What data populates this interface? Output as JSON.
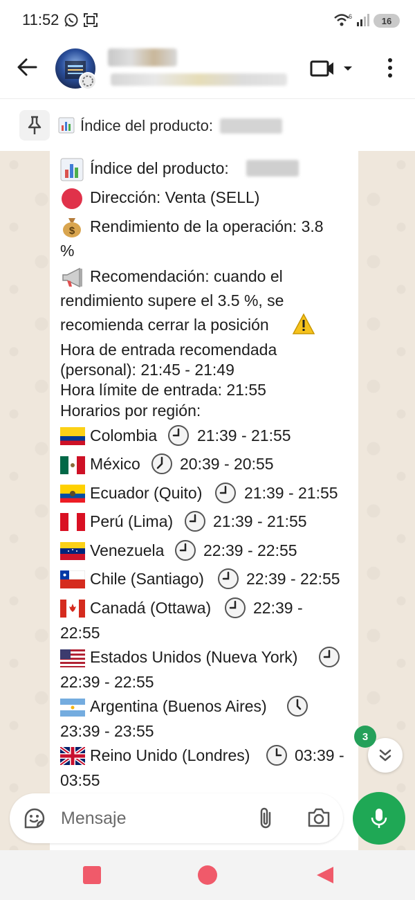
{
  "status_bar": {
    "time": "11:52",
    "battery": "16"
  },
  "header": {
    "icons": [
      "back-arrow-icon",
      "avatar",
      "video-camera-icon",
      "chevron-down-icon",
      "more-vertical-icon"
    ]
  },
  "pinned": {
    "emoji": "📊",
    "text": "Índice del producto:"
  },
  "message": {
    "product_label": "Índice del producto:",
    "direction": "Dirección: Venta (SELL)",
    "yield_line1": "Rendimiento de la operación: 3.8",
    "yield_line2": "%",
    "rec_line1": "Recomendación: cuando el",
    "rec_line2": "rendimiento supere el 3.5 %, se",
    "rec_line3": "recomienda cerrar la posición",
    "entry_line1": "Hora de entrada recomendada",
    "entry_line2": "(personal): 21:45 - 21:49",
    "limit": "Hora límite de entrada: 21:55",
    "regions_title": "Horarios por región:",
    "regions": [
      {
        "name": "Colombia",
        "time": "21:39 - 21:55"
      },
      {
        "name": "México",
        "time": "20:39 - 20:55"
      },
      {
        "name": "Ecuador (Quito)",
        "time": "21:39 - 21:55"
      },
      {
        "name": "Perú (Lima)",
        "time": "21:39 - 21:55"
      },
      {
        "name": "Venezuela",
        "time": "22:39 - 22:55"
      },
      {
        "name": "Chile (Santiago)",
        "time": "22:39 - 22:55"
      },
      {
        "name": "Canadá (Ottawa)",
        "time": "22:39 -",
        "time2": "22:55"
      },
      {
        "name": "Estados Unidos (Nueva York)",
        "time2": "22:39 - 22:55"
      },
      {
        "name": "Argentina (Buenos Aires)",
        "time2": "23:39 - 23:55"
      },
      {
        "name": "Reino Unido (Londres)",
        "time": "03:39 -",
        "time2": "03:55"
      }
    ]
  },
  "scroll": {
    "unread_count": "3"
  },
  "input": {
    "placeholder": "Mensaje"
  },
  "colors": {
    "accent_green": "#1fa855",
    "badge_green": "#25a05a",
    "nav_red": "#f05a6a",
    "chat_bg": "#efe7dc"
  }
}
